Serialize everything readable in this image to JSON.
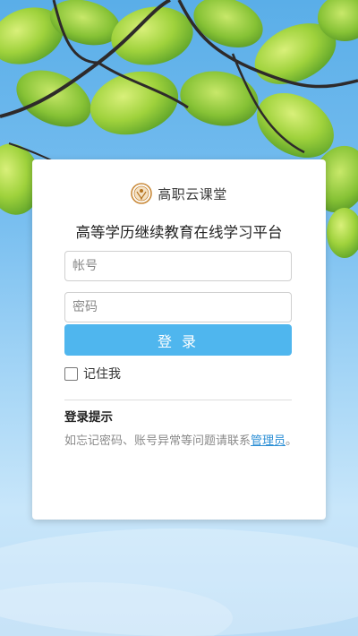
{
  "brand": {
    "name": "高职云课堂",
    "accent_color": "#c98a3a"
  },
  "login": {
    "platform_title": "高等学历继续教育在线学习平台",
    "account_placeholder": "帐号",
    "password_placeholder": "密码",
    "login_button": "登 录",
    "remember_label": "记住我",
    "button_color": "#4fb6ee"
  },
  "tips": {
    "title": "登录提示",
    "text_prefix": "如忘记密码、账号异常等问题请联系",
    "admin_link": "管理员",
    "text_suffix": "。"
  }
}
